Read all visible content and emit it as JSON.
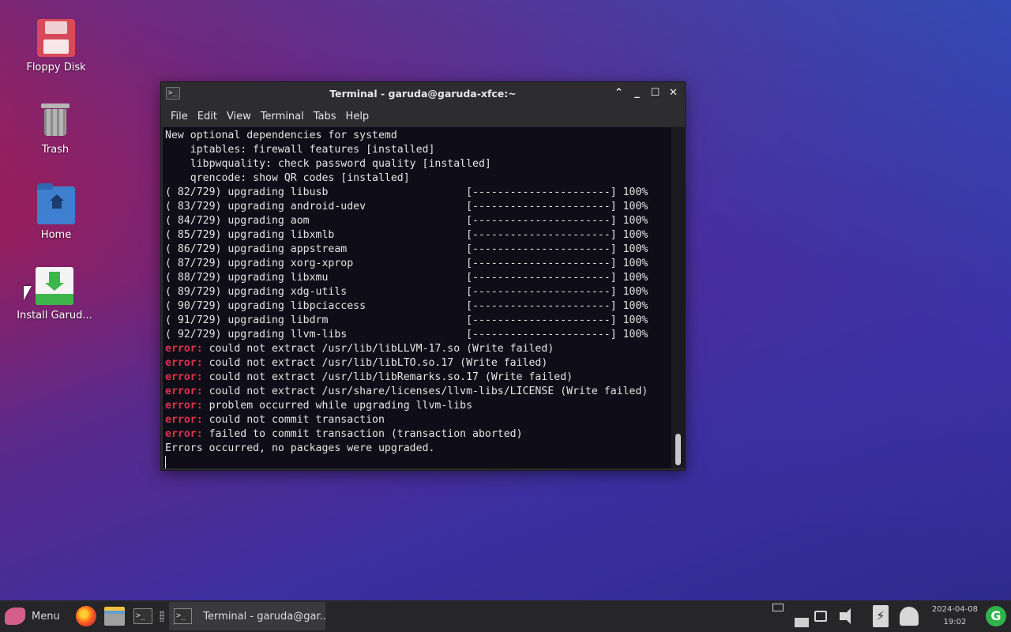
{
  "desktop": {
    "icons": [
      {
        "label": "Floppy Disk"
      },
      {
        "label": "Trash"
      },
      {
        "label": "Home"
      },
      {
        "label": "Install Garud..."
      }
    ]
  },
  "window": {
    "title": "Terminal - garuda@garuda-xfce:~",
    "app_icon_glyph": ">_",
    "controls": {
      "keep_above": "⌃",
      "minimize": "_",
      "maximize": "☐",
      "close": "✕"
    },
    "menu": [
      "File",
      "Edit",
      "View",
      "Terminal",
      "Tabs",
      "Help"
    ]
  },
  "terminal": {
    "lines": [
      {
        "type": "text",
        "text": "New optional dependencies for systemd"
      },
      {
        "type": "text",
        "text": "    iptables: firewall features [installed]"
      },
      {
        "type": "text",
        "text": "    libpwquality: check password quality [installed]"
      },
      {
        "type": "text",
        "text": "    qrencode: show QR codes [installed]"
      },
      {
        "type": "text",
        "text": "( 82/729) upgrading libusb                      [----------------------] 100%"
      },
      {
        "type": "text",
        "text": "( 83/729) upgrading android-udev                [----------------------] 100%"
      },
      {
        "type": "text",
        "text": "( 84/729) upgrading aom                         [----------------------] 100%"
      },
      {
        "type": "text",
        "text": "( 85/729) upgrading libxmlb                     [----------------------] 100%"
      },
      {
        "type": "text",
        "text": "( 86/729) upgrading appstream                   [----------------------] 100%"
      },
      {
        "type": "text",
        "text": "( 87/729) upgrading xorg-xprop                  [----------------------] 100%"
      },
      {
        "type": "text",
        "text": "( 88/729) upgrading libxmu                      [----------------------] 100%"
      },
      {
        "type": "text",
        "text": "( 89/729) upgrading xdg-utils                   [----------------------] 100%"
      },
      {
        "type": "text",
        "text": "( 90/729) upgrading libpciaccess                [----------------------] 100%"
      },
      {
        "type": "text",
        "text": "( 91/729) upgrading libdrm                      [----------------------] 100%"
      },
      {
        "type": "text",
        "text": "( 92/729) upgrading llvm-libs                   [----------------------] 100%"
      },
      {
        "type": "error",
        "prefix": "error:",
        "text": " could not extract /usr/lib/libLLVM-17.so (Write failed)"
      },
      {
        "type": "error",
        "prefix": "error:",
        "text": " could not extract /usr/lib/libLTO.so.17 (Write failed)"
      },
      {
        "type": "error",
        "prefix": "error:",
        "text": " could not extract /usr/lib/libRemarks.so.17 (Write failed)"
      },
      {
        "type": "error",
        "prefix": "error:",
        "text": " could not extract /usr/share/licenses/llvm-libs/LICENSE (Write failed)"
      },
      {
        "type": "error",
        "prefix": "error:",
        "text": " problem occurred while upgrading llvm-libs"
      },
      {
        "type": "error",
        "prefix": "error:",
        "text": " could not commit transaction"
      },
      {
        "type": "error",
        "prefix": "error:",
        "text": " failed to commit transaction (transaction aborted)"
      },
      {
        "type": "text",
        "text": "Errors occurred, no packages were upgraded."
      }
    ]
  },
  "taskbar": {
    "menu_label": "Menu",
    "task_label": "Terminal - garuda@gar...",
    "clock_date": "2024-04-08",
    "clock_time": "19:02",
    "battery_glyph": "⚡",
    "update_glyph": "G"
  },
  "colors": {
    "error": "#e0334a",
    "terminal_bg": "#0f0e18",
    "titlebar": "#2d2d30"
  }
}
